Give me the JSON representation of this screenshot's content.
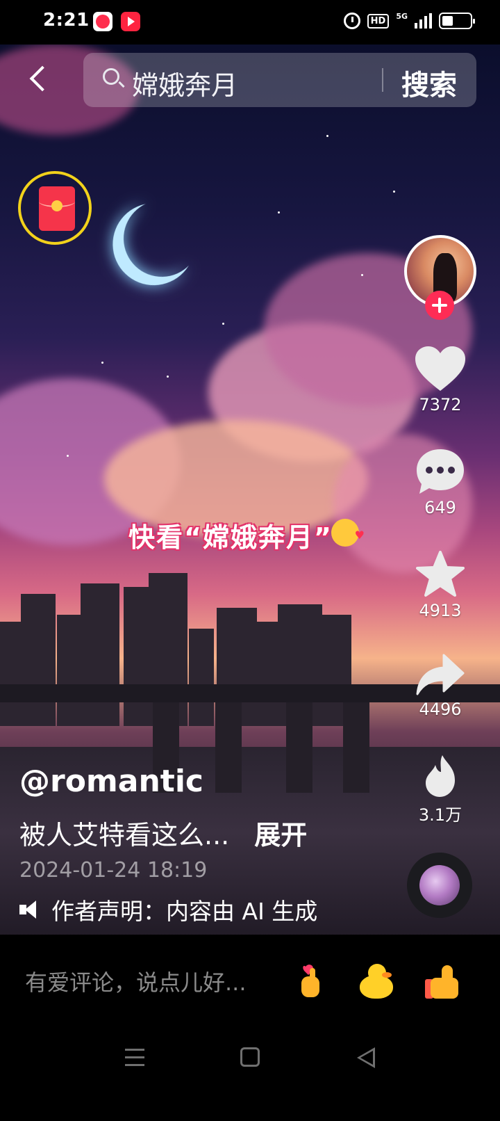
{
  "status_bar": {
    "time": "2:21",
    "hd_label": "HD",
    "network_label": "5G",
    "battery_percent": 40
  },
  "header": {
    "search_query": "嫦娥奔月",
    "search_button_label": "搜索"
  },
  "video": {
    "caption": "快看“嫦娥奔月”"
  },
  "actions": {
    "like_count": "7372",
    "comment_count": "649",
    "favorite_count": "4913",
    "share_count": "4496",
    "related_count": "3.1万"
  },
  "post": {
    "author": "@romantic",
    "description": "被人艾特看这么...",
    "expand_label": "展开",
    "timestamp": "2024-01-24 18:19",
    "declaration": "作者声明：内容由 AI 生成"
  },
  "comment_bar": {
    "placeholder": "有爱评论，说点儿好...",
    "quick_emojis": [
      "finger-heart-icon",
      "duck-icon",
      "thumbs-up-icon"
    ]
  },
  "colors": {
    "accent": "#fe2c55",
    "red_packet_ring": "#f2d21b"
  }
}
